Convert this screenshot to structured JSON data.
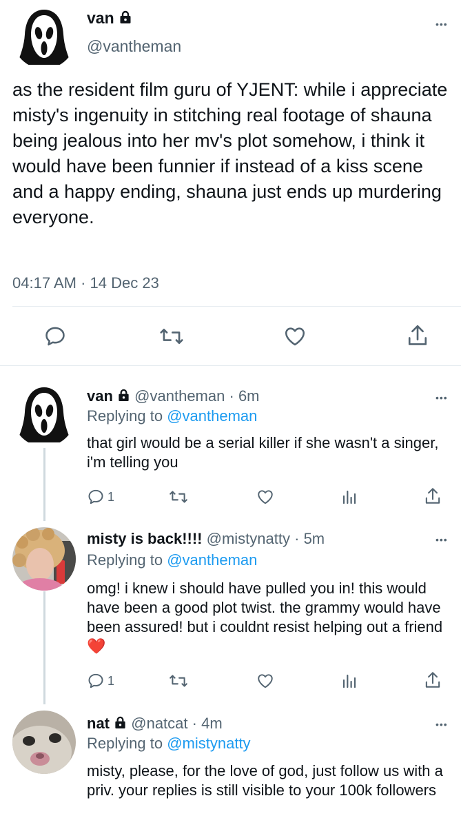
{
  "main_tweet": {
    "name": "van",
    "handle": "@vantheman",
    "text": "as the resident film guru of YJENT: while i appreciate misty's ingenuity in stitching real footage of shauna being jealous into her mv's plot somehow, i think it would have been funnier if instead of a kiss scene and a happy ending, shauna just ends up murdering everyone.",
    "time": "04:17 AM",
    "date": "14 Dec 23"
  },
  "replies": [
    {
      "name": "van",
      "handle": "@vantheman",
      "age": "6m",
      "replying_prefix": "Replying to",
      "replying_to": "@vantheman",
      "text": "that girl would be a serial killer if she wasn't a singer, i'm telling you",
      "reply_count": "1"
    },
    {
      "name": "misty is back!!!!",
      "handle": "@mistynatty",
      "age": "5m",
      "replying_prefix": "Replying to",
      "replying_to": "@vantheman",
      "text": "omg! i knew i should have pulled you in! this would have been a good plot twist. the grammy would have been assured! but i couldnt resist helping out a friend ",
      "emoji": "❤️",
      "reply_count": "1"
    },
    {
      "name": "nat",
      "handle": "@natcat",
      "age": "4m",
      "replying_prefix": "Replying to",
      "replying_to": "@mistynatty",
      "text": "misty, please, for the love of god, just follow us with a priv. your replies is still visible to your 100k followers"
    }
  ],
  "separator": "·",
  "menu_glyph": "•••",
  "icons": [
    "ghostface-avatar",
    "lock-icon",
    "reply-icon",
    "retweet-icon",
    "like-icon",
    "share-icon",
    "analytics-icon",
    "more-icon"
  ],
  "colors": {
    "link": "#1d9bf0",
    "secondary": "#536471",
    "divider": "#e6ecf0",
    "heart": "#e0245e"
  }
}
